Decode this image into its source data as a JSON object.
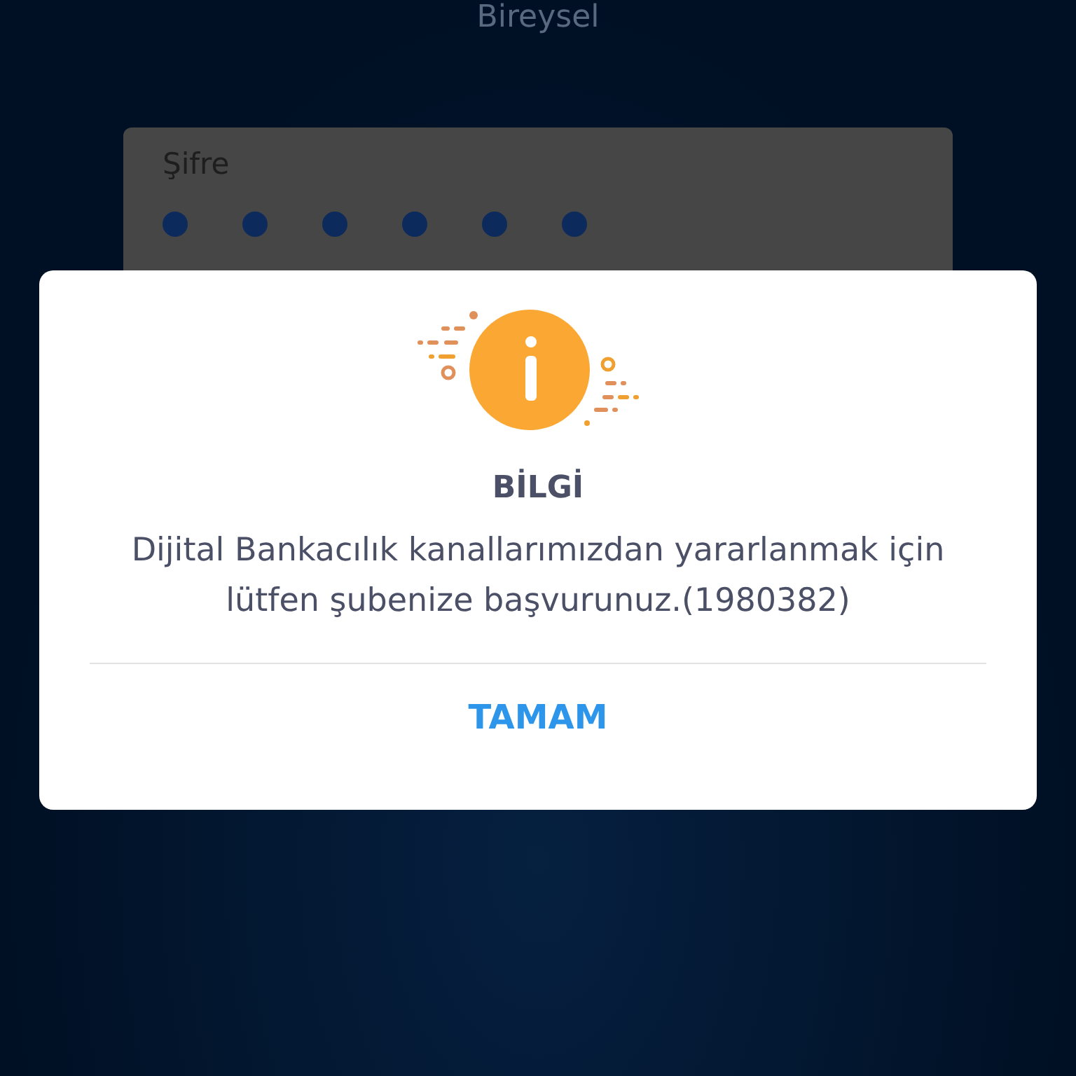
{
  "header": {
    "title": "Bireysel"
  },
  "password": {
    "label": "Şifre",
    "dots": [
      {
        "filled": true
      },
      {
        "filled": true
      },
      {
        "filled": true
      },
      {
        "filled": true
      },
      {
        "filled": true
      },
      {
        "filled": true
      }
    ]
  },
  "dialog": {
    "title": "BİLGİ",
    "message": "Dijital Bankacılık kanallarımızdan yararlanmak için lütfen şubenize başvurunuz.(1980382)",
    "buttons": [
      "TAMAM"
    ]
  }
}
